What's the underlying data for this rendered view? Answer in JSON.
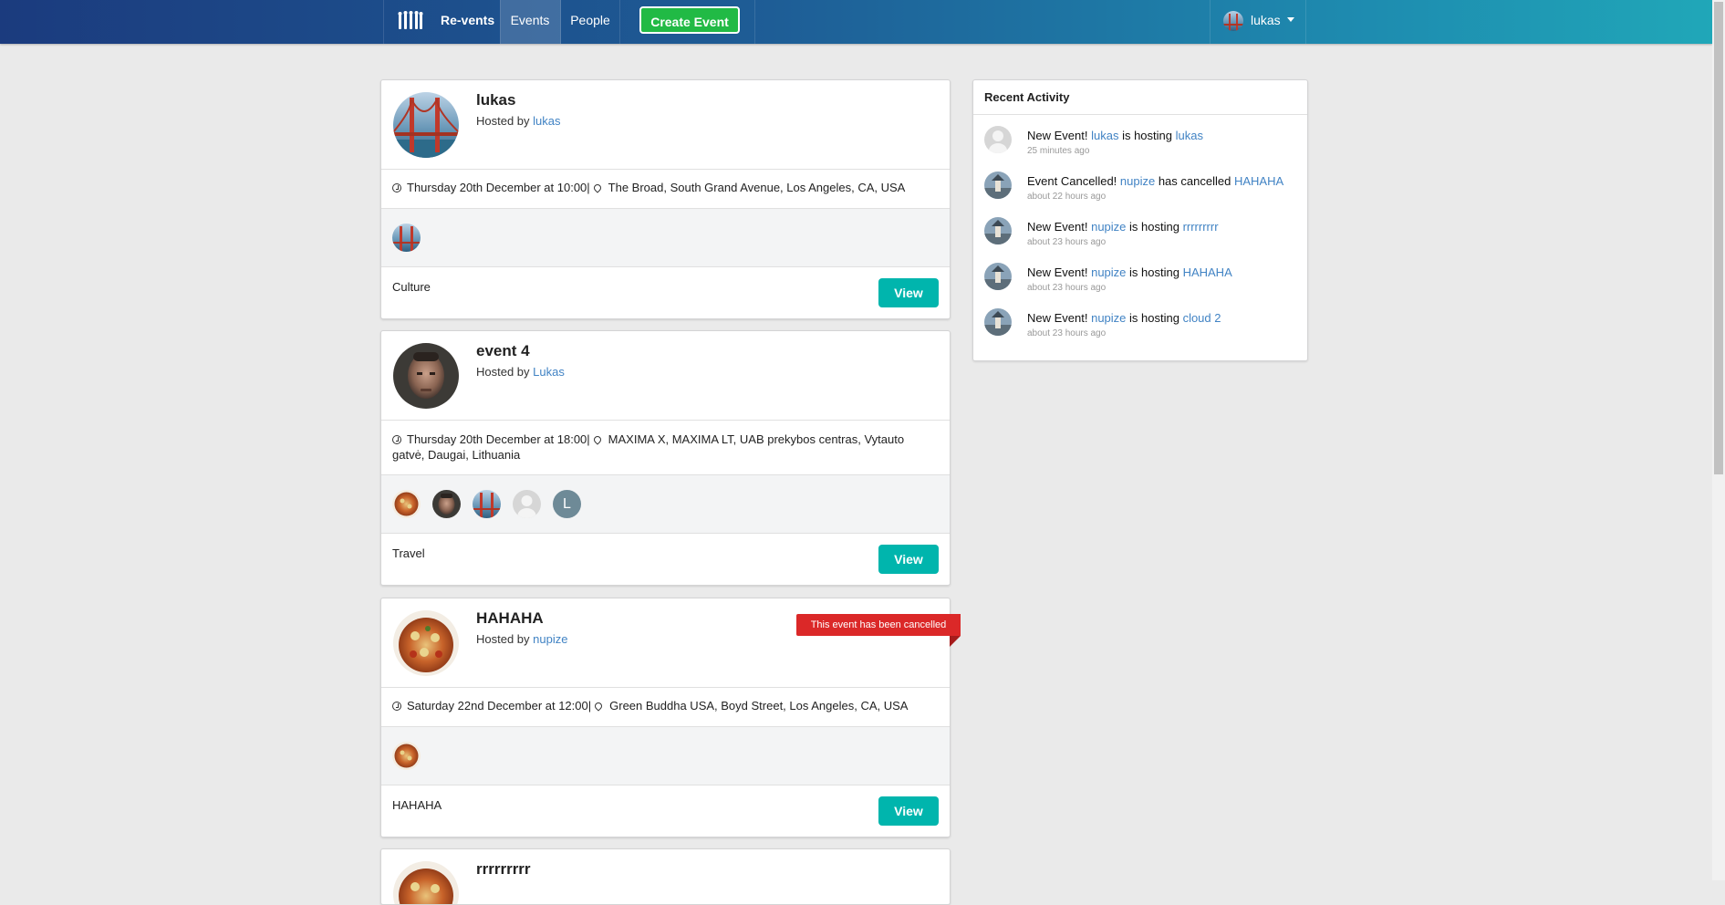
{
  "nav": {
    "brand": "Re-vents",
    "events": "Events",
    "people": "People",
    "create": "Create Event",
    "user": "lukas"
  },
  "events": [
    {
      "title": "lukas",
      "hosted_prefix": "Hosted by ",
      "host": "lukas",
      "date": "Thursday 20th December at 10:00|",
      "venue": "The Broad, South Grand Avenue, Los Angeles, CA, USA",
      "category": "Culture",
      "view": "View"
    },
    {
      "title": "event 4",
      "hosted_prefix": "Hosted by ",
      "host": "Lukas",
      "date": "Thursday 20th December at 18:00|",
      "venue": "MAXIMA X, MAXIMA LT, UAB prekybos centras, Vytauto gatvė, Daugai, Lithuania",
      "attendee_initial": "L",
      "category": "Travel",
      "view": "View"
    },
    {
      "title": "HAHAHA",
      "hosted_prefix": "Hosted by ",
      "host": "nupize",
      "date": "Saturday 22nd December at 12:00|",
      "venue": "Green Buddha USA, Boyd Street, Los Angeles, CA, USA",
      "category": "HAHAHA",
      "view": "View",
      "cancelled": "This event has been cancelled"
    },
    {
      "title": "rrrrrrrrr"
    }
  ],
  "activity": {
    "title": "Recent Activity",
    "items": [
      {
        "lead": "New Event! ",
        "user": "lukas",
        "mid": " is hosting ",
        "target": "lukas",
        "time": "25 minutes ago"
      },
      {
        "lead": "Event Cancelled! ",
        "user": "nupize",
        "mid": " has cancelled ",
        "target": "HAHAHA",
        "time": "about 22 hours ago"
      },
      {
        "lead": "New Event! ",
        "user": "nupize",
        "mid": " is hosting ",
        "target": "rrrrrrrrr",
        "time": "about 23 hours ago"
      },
      {
        "lead": "New Event! ",
        "user": "nupize",
        "mid": " is hosting ",
        "target": "HAHAHA",
        "time": "about 23 hours ago"
      },
      {
        "lead": "New Event! ",
        "user": "nupize",
        "mid": " is hosting ",
        "target": "cloud 2",
        "time": "about 23 hours ago"
      }
    ]
  },
  "colors": {
    "nav_start": "#1b3b7e",
    "nav_end": "#20a7b8",
    "create_button": "#21ba45",
    "view_button": "#00b5ad",
    "link": "#4183c4",
    "cancel_ribbon": "#db2828"
  },
  "icons": [
    "logo-icon",
    "clock-icon",
    "map-marker-icon",
    "caret-down-icon"
  ]
}
